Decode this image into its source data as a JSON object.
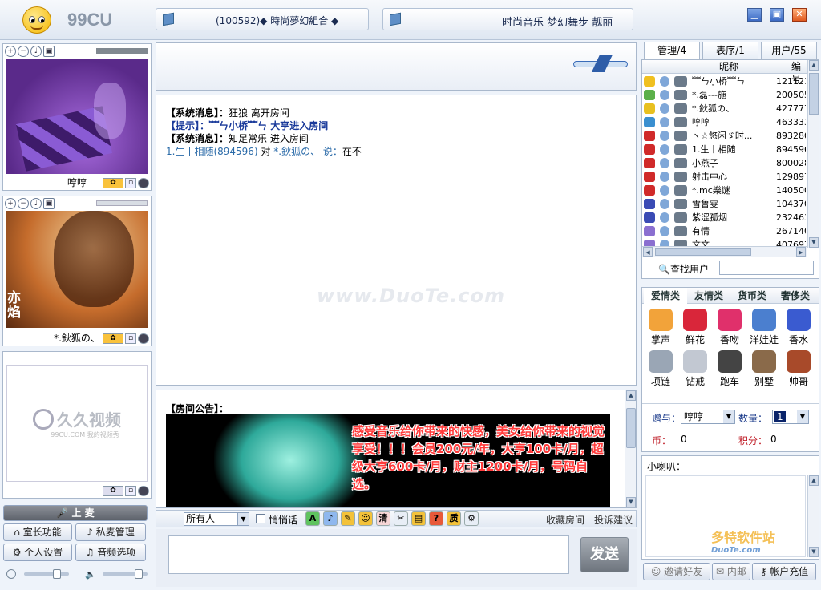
{
  "app": {
    "brand": "99CU"
  },
  "tickers": [
    {
      "text": "(100592)◆ 時尚夢幻組合 ◆"
    },
    {
      "text": "时尚音乐 梦幻舞步 靓丽"
    }
  ],
  "window_controls": {
    "minimize": "▁",
    "restore": "▣",
    "close": "✕"
  },
  "cams": [
    {
      "name": "哼哼"
    },
    {
      "name": "*.鈥狐の、",
      "watermark": "亦焰"
    },
    {
      "name": "",
      "logo_text": "久久视频",
      "logo_sub": "99CU.COM  我的视频秀"
    }
  ],
  "left_buttons": {
    "mic": "上 麦",
    "host_func": "室长功能",
    "private_manage": "私麦管理",
    "personal": "个人设置",
    "audio": "音频选项"
  },
  "chat": {
    "lines": [
      {
        "tag": "【系统消息】：",
        "text": "狂狼 离开房间",
        "style": "sys"
      },
      {
        "tag": "【提示】：",
        "text": "﹌ㄣ小桥﹌ㄣ 大亨进入房间",
        "style": "tip"
      },
      {
        "tag": "【系统消息】：",
        "text": "知足常乐 进入房间",
        "style": "sys"
      },
      {
        "tag": "",
        "from": "1.生丨相随(894596)",
        "mid": " 对 ",
        "to": "*.鈥狐の、",
        "say": " 说：",
        "text": "在不",
        "style": "talk"
      }
    ],
    "watermark": "www.DuoTe.com"
  },
  "announce": {
    "title": "【房间公告】：",
    "text": "感受音乐给你带来的快感，美女给你带来的视觉享受！！！会员200元/年，大亨100卡/月，超级大亨600卡/月，财主1200卡/月，号码自选。"
  },
  "toolbar": {
    "recipient": "所有人",
    "whisper": "悄悄话",
    "icons": [
      "A",
      "♪",
      "✎",
      "☺",
      "清",
      "✂",
      "▤",
      "?",
      "质",
      "⚙"
    ],
    "fav_room": "收藏房间",
    "complain": "投诉建议"
  },
  "send": {
    "label": "发送",
    "input_value": ""
  },
  "user_tabs": [
    "管理/4",
    "表序/1",
    "用户/55"
  ],
  "user_cols": {
    "nick": "昵称",
    "id": "编号"
  },
  "users": [
    {
      "nick": "﹌ㄣ小桥﹌ㄣ",
      "id": "121121",
      "c": "#f0c020"
    },
    {
      "nick": "*.磊---施",
      "id": "200505",
      "c": "#5bb04a"
    },
    {
      "nick": "*.鈥狐の、",
      "id": "427777",
      "c": "#e8c020"
    },
    {
      "nick": "哼哼",
      "id": "463333",
      "c": "#3a8fd0"
    },
    {
      "nick": "ヽ☆悠闲ゞ时...",
      "id": "893280",
      "c": "#d02a2a"
    },
    {
      "nick": "1.生丨相随",
      "id": "894596",
      "c": "#d02a2a"
    },
    {
      "nick": "小燕子",
      "id": "800028",
      "c": "#d02a2a"
    },
    {
      "nick": "射击中心",
      "id": "129897",
      "c": "#d02a2a"
    },
    {
      "nick": "*.mc樂谜",
      "id": "140500",
      "c": "#d02a2a"
    },
    {
      "nick": "雪鲁雯",
      "id": "104370",
      "c": "#3a4bb5"
    },
    {
      "nick": "紫涩孤烟",
      "id": "232463",
      "c": "#3a4bb5"
    },
    {
      "nick": "有情",
      "id": "267140",
      "c": "#8a6fd0"
    },
    {
      "nick": "文文",
      "id": "407697",
      "c": "#8a6fd0"
    }
  ],
  "find_user": {
    "label": "查找用户",
    "value": ""
  },
  "gift_tabs": [
    "爱情类",
    "友情类",
    "货币类",
    "奢侈类"
  ],
  "gifts": [
    {
      "name": "掌声",
      "c": "#f2a33a"
    },
    {
      "name": "鲜花",
      "c": "#d9263a"
    },
    {
      "name": "香吻",
      "c": "#e0306b"
    },
    {
      "name": "洋娃娃",
      "c": "#4b7fcf"
    },
    {
      "name": "香水",
      "c": "#3a5bd0"
    },
    {
      "name": "项链",
      "c": "#9aa6b5"
    },
    {
      "name": "钻戒",
      "c": "#c2c8d2"
    },
    {
      "name": "跑车",
      "c": "#444"
    },
    {
      "name": "别墅",
      "c": "#8a6a4a"
    },
    {
      "name": "帅哥",
      "c": "#a84a2a"
    }
  ],
  "gift_form": {
    "give_to_label": "赠与：",
    "give_to": "哼哼",
    "qty_label": "数量：",
    "qty": "1",
    "coin_label": "币：",
    "coin": "0",
    "points_label": "积分：",
    "points": "0"
  },
  "horn": {
    "label": "小喇叭："
  },
  "bottom_right": {
    "invite": "邀请好友",
    "inbox": "内邮",
    "recharge": "帐户充值"
  },
  "watermark2": {
    "text": "多特软件站",
    "sub": "DuoTe.com"
  }
}
